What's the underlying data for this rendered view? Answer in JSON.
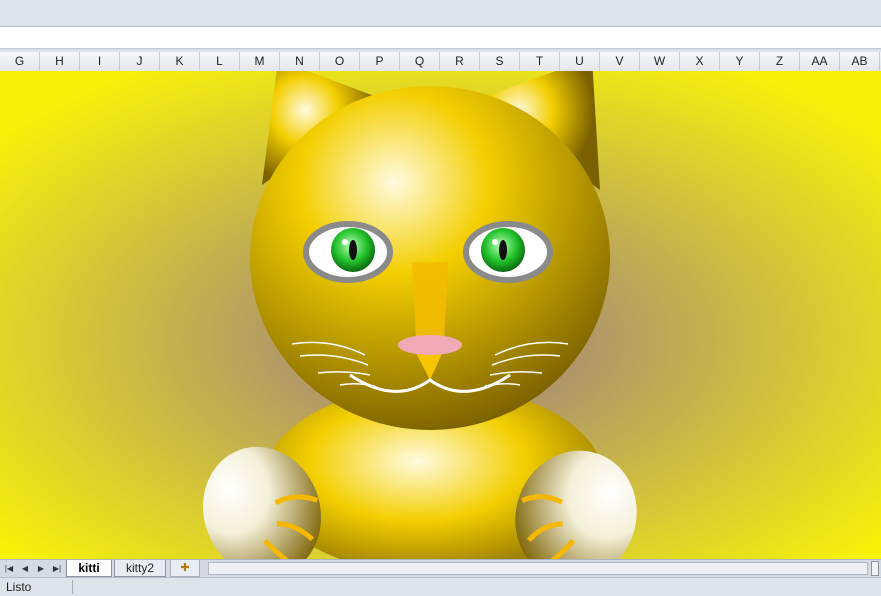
{
  "column_headers": [
    "G",
    "H",
    "I",
    "J",
    "K",
    "L",
    "M",
    "N",
    "O",
    "P",
    "Q",
    "R",
    "S",
    "T",
    "U",
    "V",
    "W",
    "X",
    "Y",
    "Z",
    "AA",
    "AB"
  ],
  "sheet_tabs": {
    "active": "kitti",
    "second": "kitty2",
    "new_sheet_icon": "insert-worksheet-icon"
  },
  "navigation_icons": [
    "first-sheet-icon",
    "prev-sheet-icon",
    "next-sheet-icon",
    "last-sheet-icon"
  ],
  "status": {
    "text": "Listo"
  },
  "colors": {
    "background_edge": "#f6f20a",
    "background_center": "#9a7888",
    "cat_body": "#f3cf00",
    "cat_highlight": "#fffbe0",
    "cat_shadow": "#7a6000",
    "eye_ring": "#8a8a8a",
    "iris": "#22c22a",
    "nose": "#f2a9b6",
    "whisker": "#ffffff"
  }
}
